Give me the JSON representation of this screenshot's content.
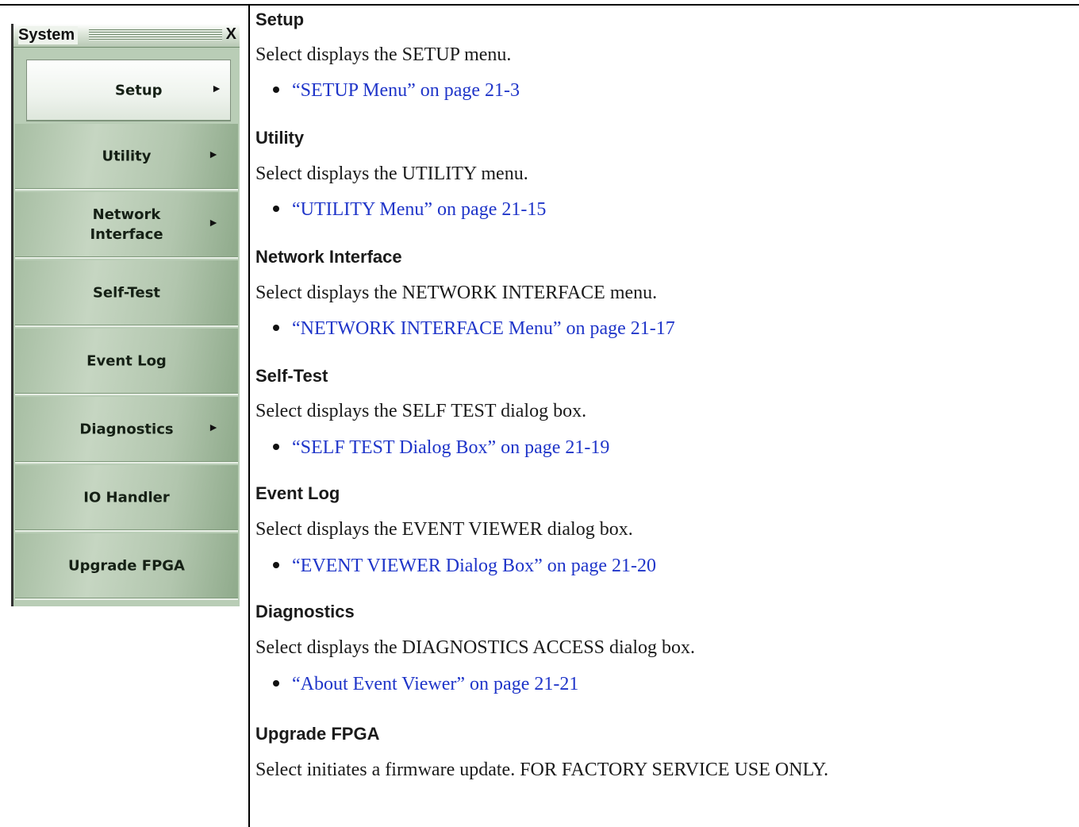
{
  "menu": {
    "title": "System",
    "close_label": "X",
    "items": [
      {
        "label": "Setup",
        "has_submenu": true,
        "active": true
      },
      {
        "label": "Utility",
        "has_submenu": true
      },
      {
        "label": "Network\nInterface",
        "has_submenu": true
      },
      {
        "label": "Self-Test",
        "has_submenu": false
      },
      {
        "label": "Event Log",
        "has_submenu": false
      },
      {
        "label": "Diagnostics",
        "has_submenu": true
      },
      {
        "label": "IO Handler",
        "has_submenu": false
      },
      {
        "label": "Upgrade FPGA",
        "has_submenu": false
      }
    ],
    "submenu_arrow": "►"
  },
  "sections": [
    {
      "heading": "Setup",
      "text": "Select displays the SETUP menu.",
      "link": "“SETUP Menu” on page 21-3"
    },
    {
      "heading": "Utility",
      "text": "Select displays the UTILITY menu.",
      "link": "“UTILITY Menu” on page 21-15"
    },
    {
      "heading": "Network Interface",
      "text": "Select displays the NETWORK INTERFACE menu.",
      "link": "“NETWORK INTERFACE Menu” on page 21-17"
    },
    {
      "heading": "Self-Test",
      "text": "Select displays the SELF TEST dialog box.",
      "link": "“SELF TEST Dialog Box” on page 21-19"
    },
    {
      "heading": "Event Log",
      "text": "Select displays the EVENT VIEWER dialog box.",
      "link": "“EVENT VIEWER Dialog Box” on page 21-20"
    },
    {
      "heading": "Diagnostics",
      "text": "Select displays the DIAGNOSTICS ACCESS dialog box.",
      "link": "“About Event Viewer” on page 21-21"
    },
    {
      "heading": "Upgrade FPGA",
      "text": "Select initiates a firmware update. FOR FACTORY SERVICE USE ONLY."
    }
  ],
  "colors": {
    "link": "#1f35c9",
    "menu_bg": "#b9cdb6"
  }
}
